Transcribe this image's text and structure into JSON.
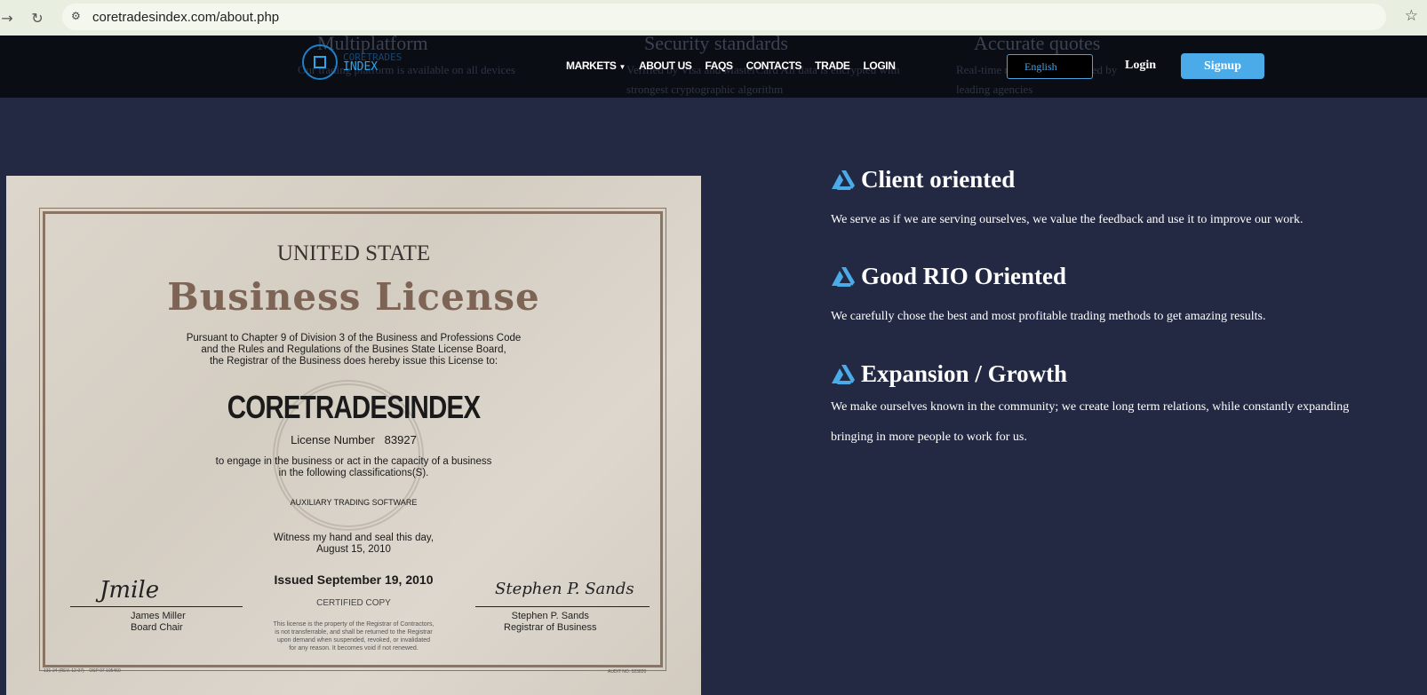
{
  "browser": {
    "url": "coretradesindex.com/about.php"
  },
  "ghost_features": [
    {
      "title": "Multiplatform",
      "text": "Our trading platform is available on all devices"
    },
    {
      "title": "Security standards",
      "text": "Verified by Visa and MasterCard All data is encrypted with strongest cryptographic algorithm"
    },
    {
      "title": "Accurate quotes",
      "text": "Real-time market data provided by leading agencies"
    }
  ],
  "logo": {
    "line1": "CORETRADES",
    "line2": "INDEX"
  },
  "nav": {
    "items": [
      "MARKETS",
      "ABOUT US",
      "FAQS",
      "CONTACTS",
      "TRADE",
      "LOGIN"
    ],
    "language": "English",
    "login": "Login",
    "signup": "Signup"
  },
  "certificate": {
    "header": "UNITED STATE",
    "title": "Business License",
    "intro": [
      "Pursuant to Chapter 9 of Division 3 of the Business and Professions Code",
      "and the Rules and Regulations of the Busines State License Board,",
      "the Registrar of the Business does hereby issue this License to:"
    ],
    "company": "CORETRADESINDEX",
    "license_label": "License Number",
    "license_number": "83927",
    "engage": [
      "to engage in the business or act in the capacity of a business",
      "in the following classifications(S)."
    ],
    "classification": "AUXILIARY TRADING SOFTWARE",
    "witness": [
      "Witness my hand and seal this day,",
      "August 15, 2010"
    ],
    "issued": "Issued September 19, 2010",
    "certified": "CERTIFIED COPY",
    "left_name": "James Miller",
    "left_title": "Board Chair",
    "right_name": "Stephen P. Sands",
    "right_title": "Registrar of Business",
    "notice": [
      "This license is the property of the Registrar of Contractors,",
      "is not transferrable, and shall be returned to the Registrar",
      "upon demand when suspended, revoked, or invalidated",
      "for any reason. It becomes void if not renewed."
    ],
    "footer_left": "131-24 (REV. 12-07)",
    "footer_osp": "OSP 07 105460",
    "footer_right": "AUDIT NO. 523820"
  },
  "features": [
    {
      "title": "Client oriented",
      "text": "We serve as if we are serving ourselves, we value the feedback and use it to improve our work."
    },
    {
      "title": "Good RIO Oriented",
      "text": "We carefully chose the best and most profitable trading methods to get amazing results."
    },
    {
      "title": "Expansion / Growth",
      "text": "We make ourselves known in the community; we create long term relations, while constantly expanding",
      "text2": "bringing in more people to work for us."
    }
  ],
  "colors": {
    "accent": "#4aabe8",
    "background": "#232943",
    "nav": "#0a0d14"
  }
}
